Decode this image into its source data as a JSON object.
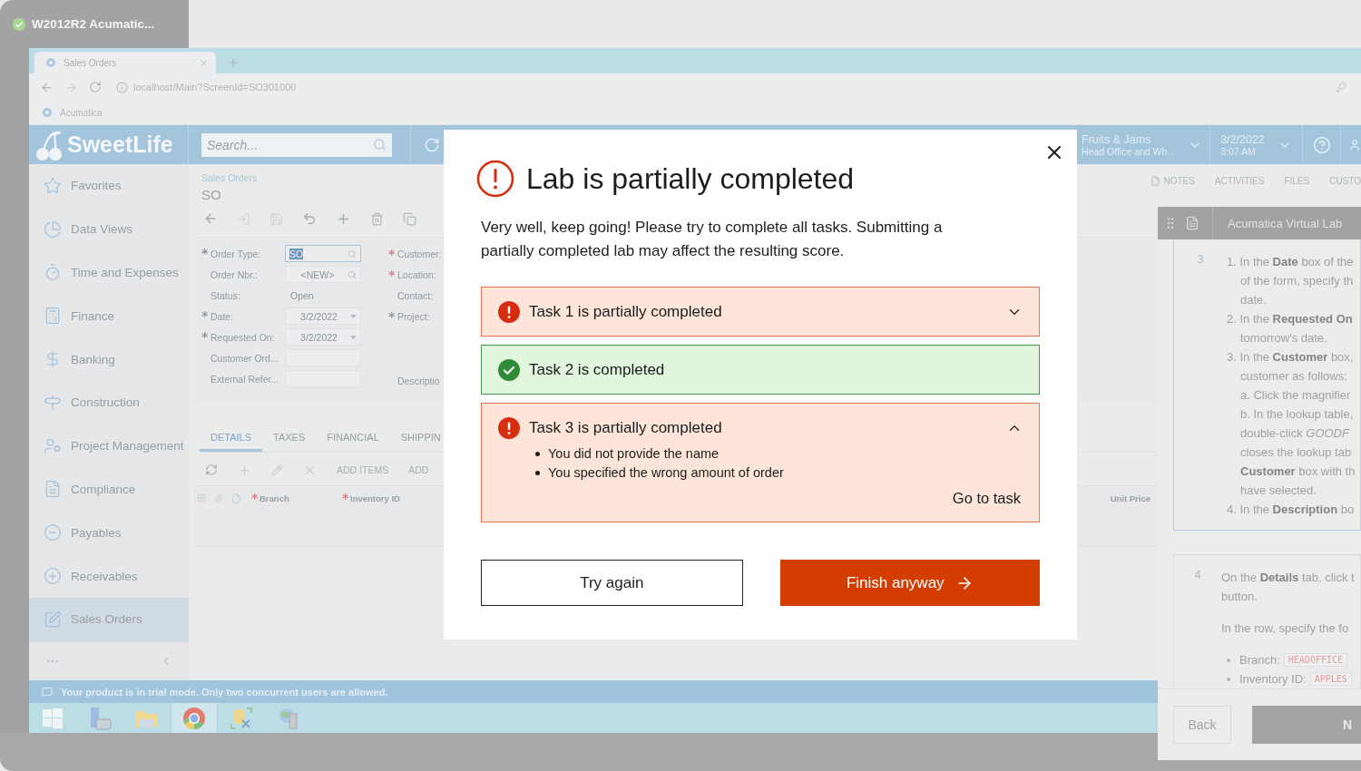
{
  "vm_tab": {
    "title": "W2012R2 Acumatic..."
  },
  "browser": {
    "tab_title": "Sales Orders",
    "url": "localhost/Main?ScreenId=SO301000",
    "bookmarks": [
      "Acumatica"
    ]
  },
  "app_header": {
    "logo": "SweetLife",
    "search": {
      "placeholder": "Search..."
    },
    "company": "Fruits & Jams",
    "branch": "Head Office and Wh...",
    "date": "3/2/2022",
    "time": "3:07 AM"
  },
  "sidebar": {
    "items": [
      {
        "label": "Favorites",
        "selected": false
      },
      {
        "label": "Data Views",
        "selected": false
      },
      {
        "label": "Time and Expenses",
        "selected": false
      },
      {
        "label": "Finance",
        "selected": false
      },
      {
        "label": "Banking",
        "selected": false
      },
      {
        "label": "Construction",
        "selected": false
      },
      {
        "label": "Project Management",
        "selected": false
      },
      {
        "label": "Compliance",
        "selected": false
      },
      {
        "label": "Payables",
        "selected": false
      },
      {
        "label": "Receivables",
        "selected": false
      },
      {
        "label": "Sales Orders",
        "selected": true
      }
    ]
  },
  "page": {
    "breadcrumb": "Sales Orders",
    "title": "SO",
    "actions": [
      "NOTES",
      "ACTIVITIES",
      "FILES",
      "CUSTO"
    ],
    "fields": [
      {
        "mark": "*",
        "label": "Order Type:",
        "kind": "lookup",
        "value": "SO",
        "highlighted": true
      },
      {
        "label": "Order Nbr.:",
        "kind": "lookup",
        "value": "<NEW>",
        "highlighted": false
      },
      {
        "label": "Status:",
        "kind": "text",
        "value": "Open"
      },
      {
        "mark": "*",
        "label": "Date:",
        "kind": "date",
        "value": "3/2/2022"
      },
      {
        "mark": "*",
        "label": "Requested On:",
        "kind": "date",
        "value": "3/2/2022"
      },
      {
        "label": "Customer Ord...",
        "kind": "input"
      },
      {
        "label": "External Refer...",
        "kind": "input"
      }
    ],
    "side_fields": [
      {
        "mark": "*",
        "label": "Customer:",
        "color": "#d98080"
      },
      {
        "mark": "*",
        "label": "Location:",
        "color": "#d98080"
      },
      {
        "label": "Contact:"
      },
      {
        "mark": "*",
        "label": "Project:",
        "color": "#8f9396"
      },
      {
        "label": "Descriptio"
      }
    ],
    "tabs": [
      {
        "label": "DETAILS",
        "selected": true
      },
      {
        "label": "TAXES",
        "selected": false
      },
      {
        "label": "FINANCIAL",
        "selected": false
      },
      {
        "label": "SHIPPIN",
        "selected": false
      }
    ],
    "grid_buttons": [
      "ADD ITEMS",
      "ADD"
    ],
    "columns": [
      {
        "mark": "*",
        "label": "Branch",
        "color": "#d98080"
      },
      {
        "mark": "*",
        "label": "Inventory ID",
        "color": "#d98080"
      },
      {
        "label": "Unit Price"
      }
    ]
  },
  "trial_notice": "Your product is in trial mode. Only two concurrent users are allowed.",
  "taskbar": [
    {
      "selected": false
    },
    {
      "selected": false
    },
    {
      "selected": false
    },
    {
      "selected": true
    },
    {
      "selected": false
    },
    {
      "selected": false
    }
  ],
  "lab_panel": {
    "title": "Acumatica Virtual Lab",
    "steps": [
      {
        "number": "3",
        "lines": [
          {
            "kind": "item",
            "text": "1. In the **Date** box of the"
          },
          {
            "kind": "cont",
            "text": "of the form, specify th"
          },
          {
            "kind": "cont",
            "text": "date."
          },
          {
            "kind": "item",
            "text": "2. In the **Requested On**"
          },
          {
            "kind": "cont",
            "text": "tomorrow's date."
          },
          {
            "kind": "item",
            "text": "3. In the **Customer** box,"
          },
          {
            "kind": "cont",
            "text": "customer as follows:"
          },
          {
            "kind": "cont",
            "text": "a. Click the magnifier"
          },
          {
            "kind": "cont",
            "text": "b. In the lookup table,"
          },
          {
            "kind": "cont",
            "text": "double-click *GOODF*"
          },
          {
            "kind": "cont",
            "text": "closes the lookup tab"
          },
          {
            "kind": "cont",
            "text": "**Customer** box with th"
          },
          {
            "kind": "cont",
            "text": "have selected."
          },
          {
            "kind": "item",
            "text": "4. In the **Description** bo"
          }
        ]
      },
      {
        "number": "4",
        "lines": [
          {
            "kind": "plain",
            "text": "On the **Details** tab, click t"
          },
          {
            "kind": "plain",
            "text": "button."
          }
        ],
        "para": "In the row, specify the fo",
        "bullets": [
          {
            "label": "Branch:",
            "code": "HEADOFFICE"
          },
          {
            "label": "Inventory ID:",
            "code": "APPLES"
          }
        ]
      }
    ],
    "buttons": [
      "Back",
      "N"
    ]
  },
  "dialog": {
    "title": "Lab is partially completed",
    "message": "Very well, keep going! Please try to complete all tasks. Submitting a partially completed lab may affect the resulting score.",
    "tasks": [
      {
        "title": "Task 1 is partially completed",
        "kind": "partial",
        "expanded": false
      },
      {
        "title": "Task 2 is completed",
        "kind": "complete"
      },
      {
        "title": "Task 3 is partially completed",
        "kind": "partial",
        "expanded": true,
        "issues": [
          "You did not provide the name",
          "You specified the wrong amount of order"
        ],
        "link": "Go to task"
      }
    ],
    "buttons": [
      "Try again",
      "Finish anyway"
    ]
  }
}
